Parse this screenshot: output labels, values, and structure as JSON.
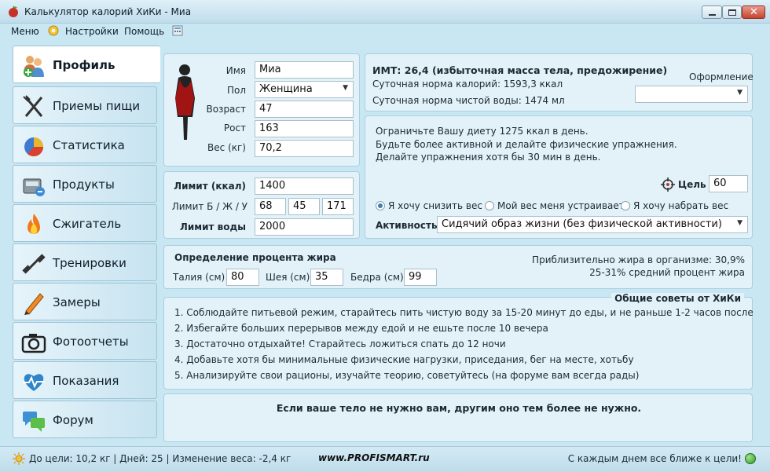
{
  "window": {
    "title": "Калькулятор калорий ХиКи - Миа"
  },
  "menu": {
    "items": [
      "Меню",
      "Настройки",
      "Помощь"
    ]
  },
  "sidebar": {
    "items": [
      {
        "label": "Профиль",
        "icon": "people-icon",
        "active": true
      },
      {
        "label": "Приемы пищи",
        "icon": "fork-knife-icon"
      },
      {
        "label": "Статистика",
        "icon": "pie-chart-icon"
      },
      {
        "label": "Продукты",
        "icon": "scale-icon"
      },
      {
        "label": "Сжигатель",
        "icon": "flame-icon"
      },
      {
        "label": "Тренировки",
        "icon": "dumbbell-icon"
      },
      {
        "label": "Замеры",
        "icon": "pencil-icon"
      },
      {
        "label": "Фотоотчеты",
        "icon": "camera-icon"
      },
      {
        "label": "Показания",
        "icon": "heart-pulse-icon"
      },
      {
        "label": "Форум",
        "icon": "chat-icon"
      }
    ]
  },
  "profile": {
    "name_label": "Имя",
    "name_value": "Миа",
    "gender_label": "Пол",
    "gender_value": "Женщина",
    "age_label": "Возраст",
    "age_value": "47",
    "height_label": "Рост",
    "height_value": "163",
    "weight_label": "Вес (кг)",
    "weight_value": "70,2"
  },
  "limits": {
    "kcal_label": "Лимит (ккал)",
    "kcal_value": "1400",
    "bju_label": "Лимит Б / Ж / У",
    "b_value": "68",
    "j_value": "45",
    "u_value": "171",
    "water_label": "Лимит воды",
    "water_value": "2000"
  },
  "bmi": {
    "headline": "ИМТ: 26,4 (избыточная масса тела, предожирение)",
    "calories": "Суточная норма калорий: 1593,3 ккал",
    "water": "Суточная норма чистой воды: 1474 мл",
    "theme_label": "Оформление",
    "theme_value": ""
  },
  "advice": {
    "line1": "Ограничьте Вашу диету 1275 ккал в день.",
    "line2": "Будьте более активной и делайте физические упражнения.",
    "line3": "Делайте упражнения хотя бы 30 мин в день.",
    "goal_label": "Цель",
    "goal_value": "60",
    "radio1": "Я хочу снизить вес",
    "radio2": "Мой вес меня устраивает",
    "radio3": "Я хочу набрать вес",
    "activity_label": "Активность",
    "activity_value": "Сидячий образ жизни (без физической активности)"
  },
  "fat": {
    "title": "Определение процента жира",
    "waist_label": "Талия (см)",
    "waist_value": "80",
    "neck_label": "Шея (см)",
    "neck_value": "35",
    "hips_label": "Бедра (см)",
    "hips_value": "99",
    "approx": "Приблизительно жира в организме: 30,9%",
    "avg": "25-31% средний процент жира"
  },
  "tips": {
    "title": "Общие советы от ХиКи",
    "items": [
      "1. Соблюдайте питьевой режим, старайтесь пить чистую воду за 15-20 минут до еды, и не раньше 1-2 часов после",
      "2. Избегайте больших перерывов между едой и не ешьте после 10 вечера",
      "3. Достаточно отдыхайте! Старайтесь ложиться спать до 12 ночи",
      "4. Добавьте хотя бы минимальные физические нагрузки, приседания, бег на месте, хотьбу",
      "5. Анализируйте свои рационы, изучайте теорию, советуйтесь (на форуме вам всегда рады)"
    ]
  },
  "quote": "Если ваше тело не нужно вам, другим оно тем более не нужно.",
  "status": {
    "left": "До цели: 10,2 кг | Дней: 25 | Изменение веса: -2,4 кг",
    "watermark": "www.PROFISMART.ru",
    "right": "С каждым днем все ближе к цели!"
  },
  "colors": {
    "background": "#c9e6f3",
    "panel": "#e3f2f9",
    "accent": "#3d7fb5",
    "status_ok": "#35b035"
  }
}
